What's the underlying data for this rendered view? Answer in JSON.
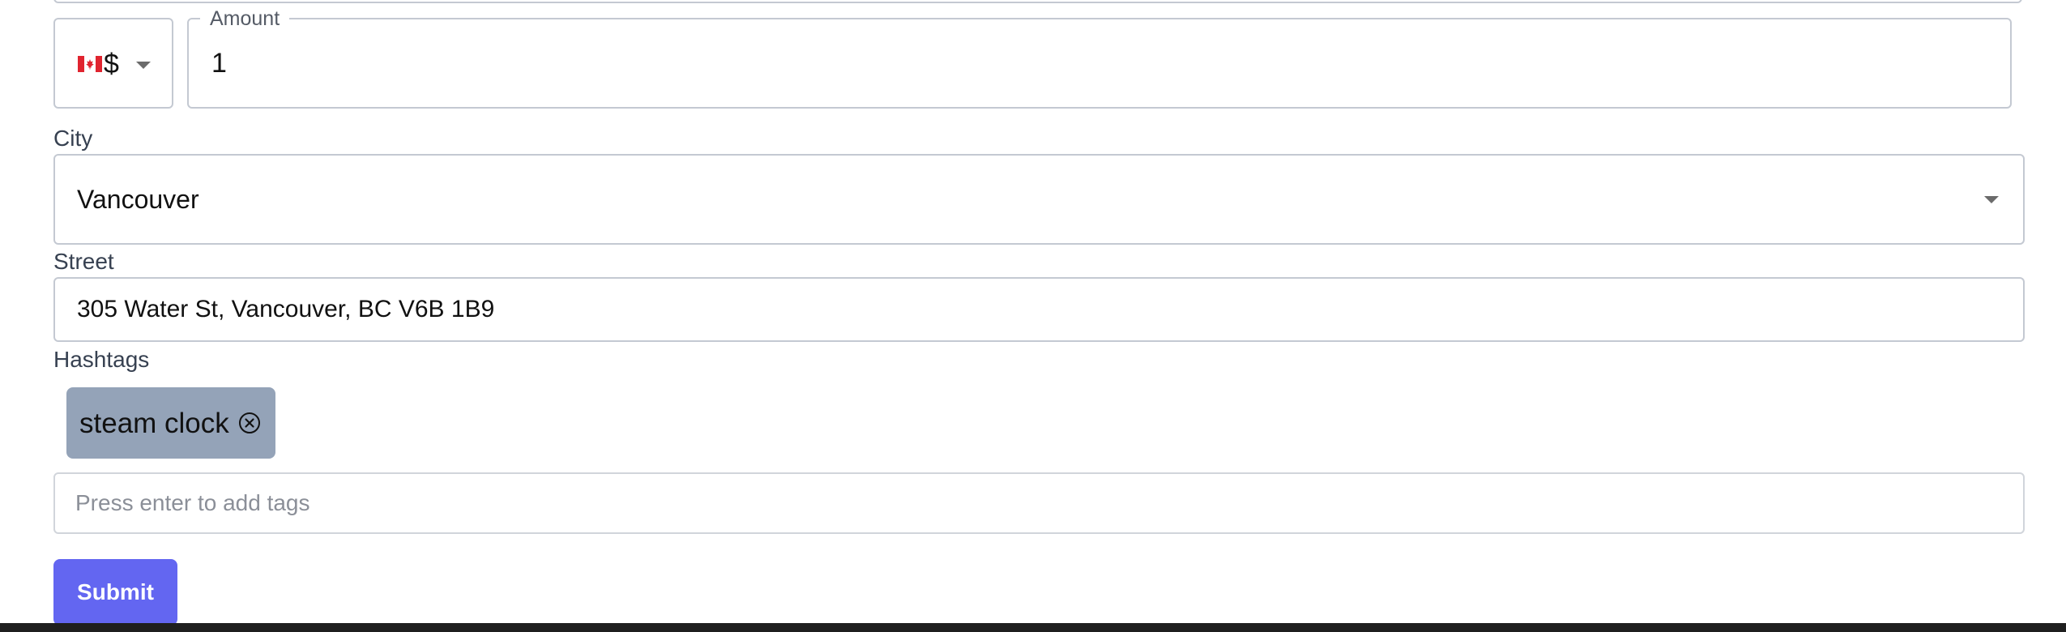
{
  "currency": {
    "flag_icon": "canada-flag-icon",
    "symbol": "$"
  },
  "amount": {
    "label": "Amount",
    "value": "1"
  },
  "city": {
    "label": "City",
    "value": "Vancouver"
  },
  "street": {
    "label": "Street",
    "value": "305 Water St, Vancouver, BC V6B 1B9"
  },
  "hashtags": {
    "label": "Hashtags",
    "tags": [
      {
        "label": "steam clock",
        "remove_icon": "circle-x-icon"
      }
    ],
    "input_placeholder": "Press enter to add tags"
  },
  "submit": {
    "label": "Submit"
  },
  "colors": {
    "accent": "#6366f1",
    "tag_background": "#94a3b8",
    "border": "#c4c9d2"
  }
}
